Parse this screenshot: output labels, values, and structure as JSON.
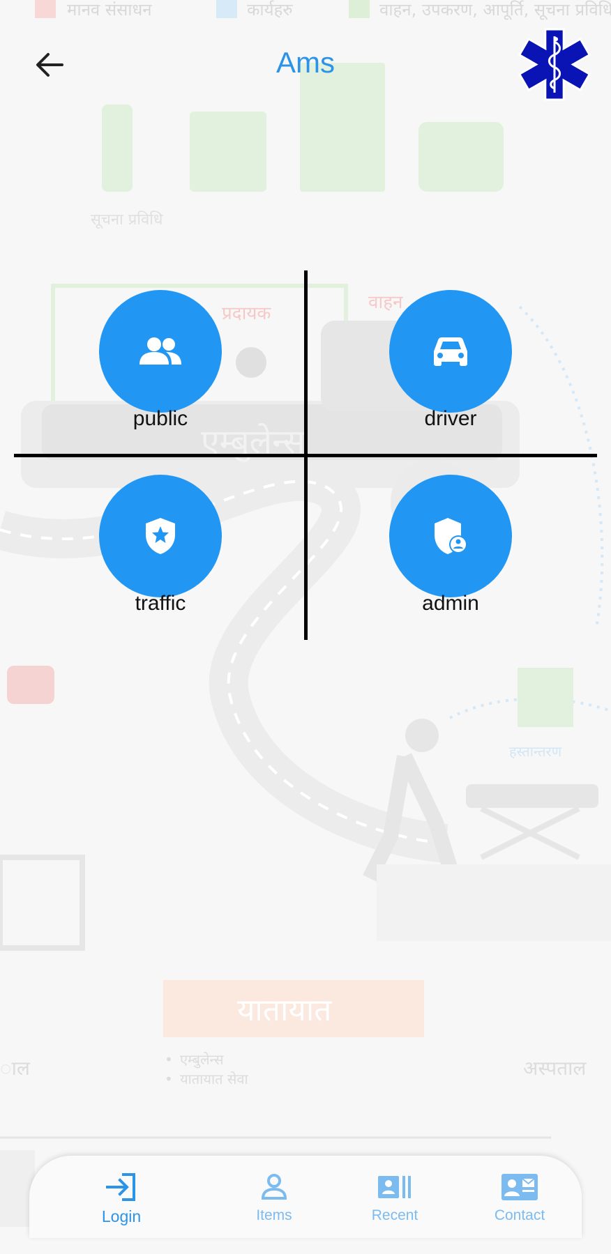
{
  "app_bar": {
    "title": "Ams"
  },
  "background": {
    "legend": [
      "मानव संसाधन",
      "कार्यहरु",
      "वाहन, उपकरण, आपूर्ति, सूचना प्रविधि"
    ],
    "labels": [
      "सूचना प्रविधि",
      "प्रदायक",
      "वाहन",
      "एम्बुलेन्स",
      "हस्तान्तरण",
      "यातायात",
      "अस्पताल",
      "ाल"
    ],
    "bullets": [
      "एम्बुलेन्स",
      "यातायात सेवा"
    ]
  },
  "roles": [
    {
      "label": "public",
      "icon": "people-icon"
    },
    {
      "label": "driver",
      "icon": "car-icon"
    },
    {
      "label": "traffic",
      "icon": "shield-star-icon"
    },
    {
      "label": "admin",
      "icon": "admin-shield-icon"
    }
  ],
  "bottom_nav": {
    "items": [
      {
        "label": "Login",
        "icon": "login-icon",
        "active": true
      },
      {
        "label": "Items",
        "icon": "person-icon",
        "active": false
      },
      {
        "label": "Recent",
        "icon": "recent-icon",
        "active": false
      },
      {
        "label": "Contact",
        "icon": "contact-card-icon",
        "active": false
      }
    ]
  },
  "colors": {
    "accent": "#2196F3",
    "title": "#2B93E8",
    "nav_inactive": "#7BBBF0",
    "logo_blue": "#0A14B4"
  }
}
